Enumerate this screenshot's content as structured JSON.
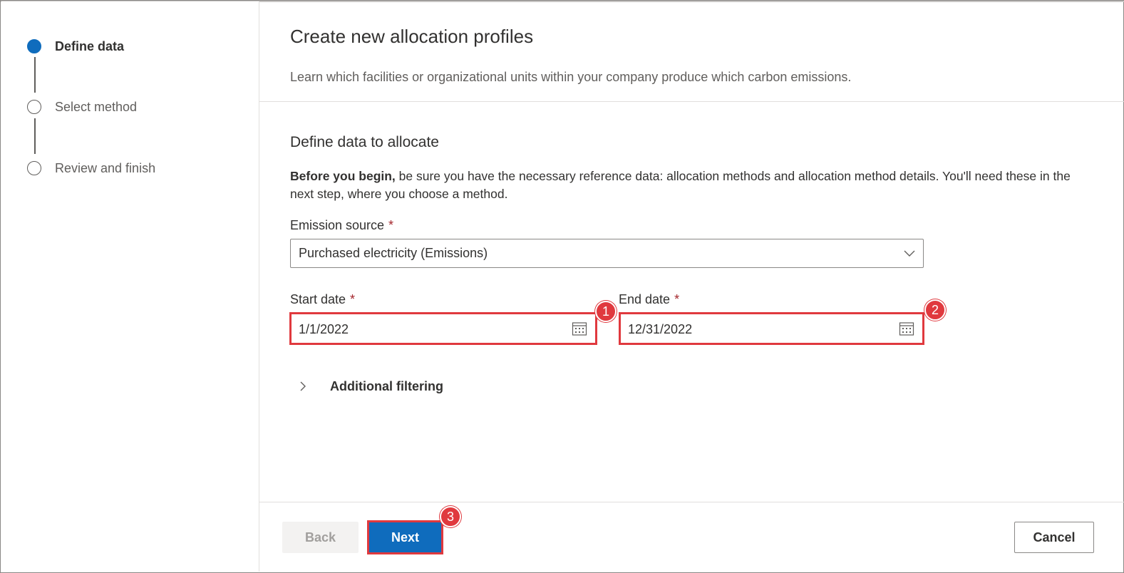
{
  "steps": [
    {
      "label": "Define data",
      "state": "active"
    },
    {
      "label": "Select method",
      "state": "inactive"
    },
    {
      "label": "Review and finish",
      "state": "inactive"
    }
  ],
  "header": {
    "title": "Create new allocation profiles",
    "subtitle": "Learn which facilities or organizational units within your company produce which carbon emissions."
  },
  "section": {
    "title": "Define data to allocate",
    "desc_bold": "Before you begin,",
    "desc_rest": " be sure you have the necessary reference data: allocation methods and allocation method details. You'll need these in the next step, where you choose a method."
  },
  "emission_source": {
    "label": "Emission source",
    "required_mark": "*",
    "value": "Purchased electricity (Emissions)",
    "icon": "chevron-down-icon"
  },
  "start_date": {
    "label": "Start date",
    "required_mark": "*",
    "value": "1/1/2022",
    "icon": "calendar-icon",
    "badge": "1"
  },
  "end_date": {
    "label": "End date",
    "required_mark": "*",
    "value": "12/31/2022",
    "icon": "calendar-icon",
    "badge": "2"
  },
  "additional_filtering": {
    "label": "Additional filtering",
    "icon": "chevron-right-icon",
    "expanded": false
  },
  "footer": {
    "back_label": "Back",
    "next_label": "Next",
    "next_badge": "3",
    "cancel_label": "Cancel"
  },
  "colors": {
    "accent": "#0f6cbd",
    "highlight": "#e0393e",
    "required": "#a4262c"
  }
}
